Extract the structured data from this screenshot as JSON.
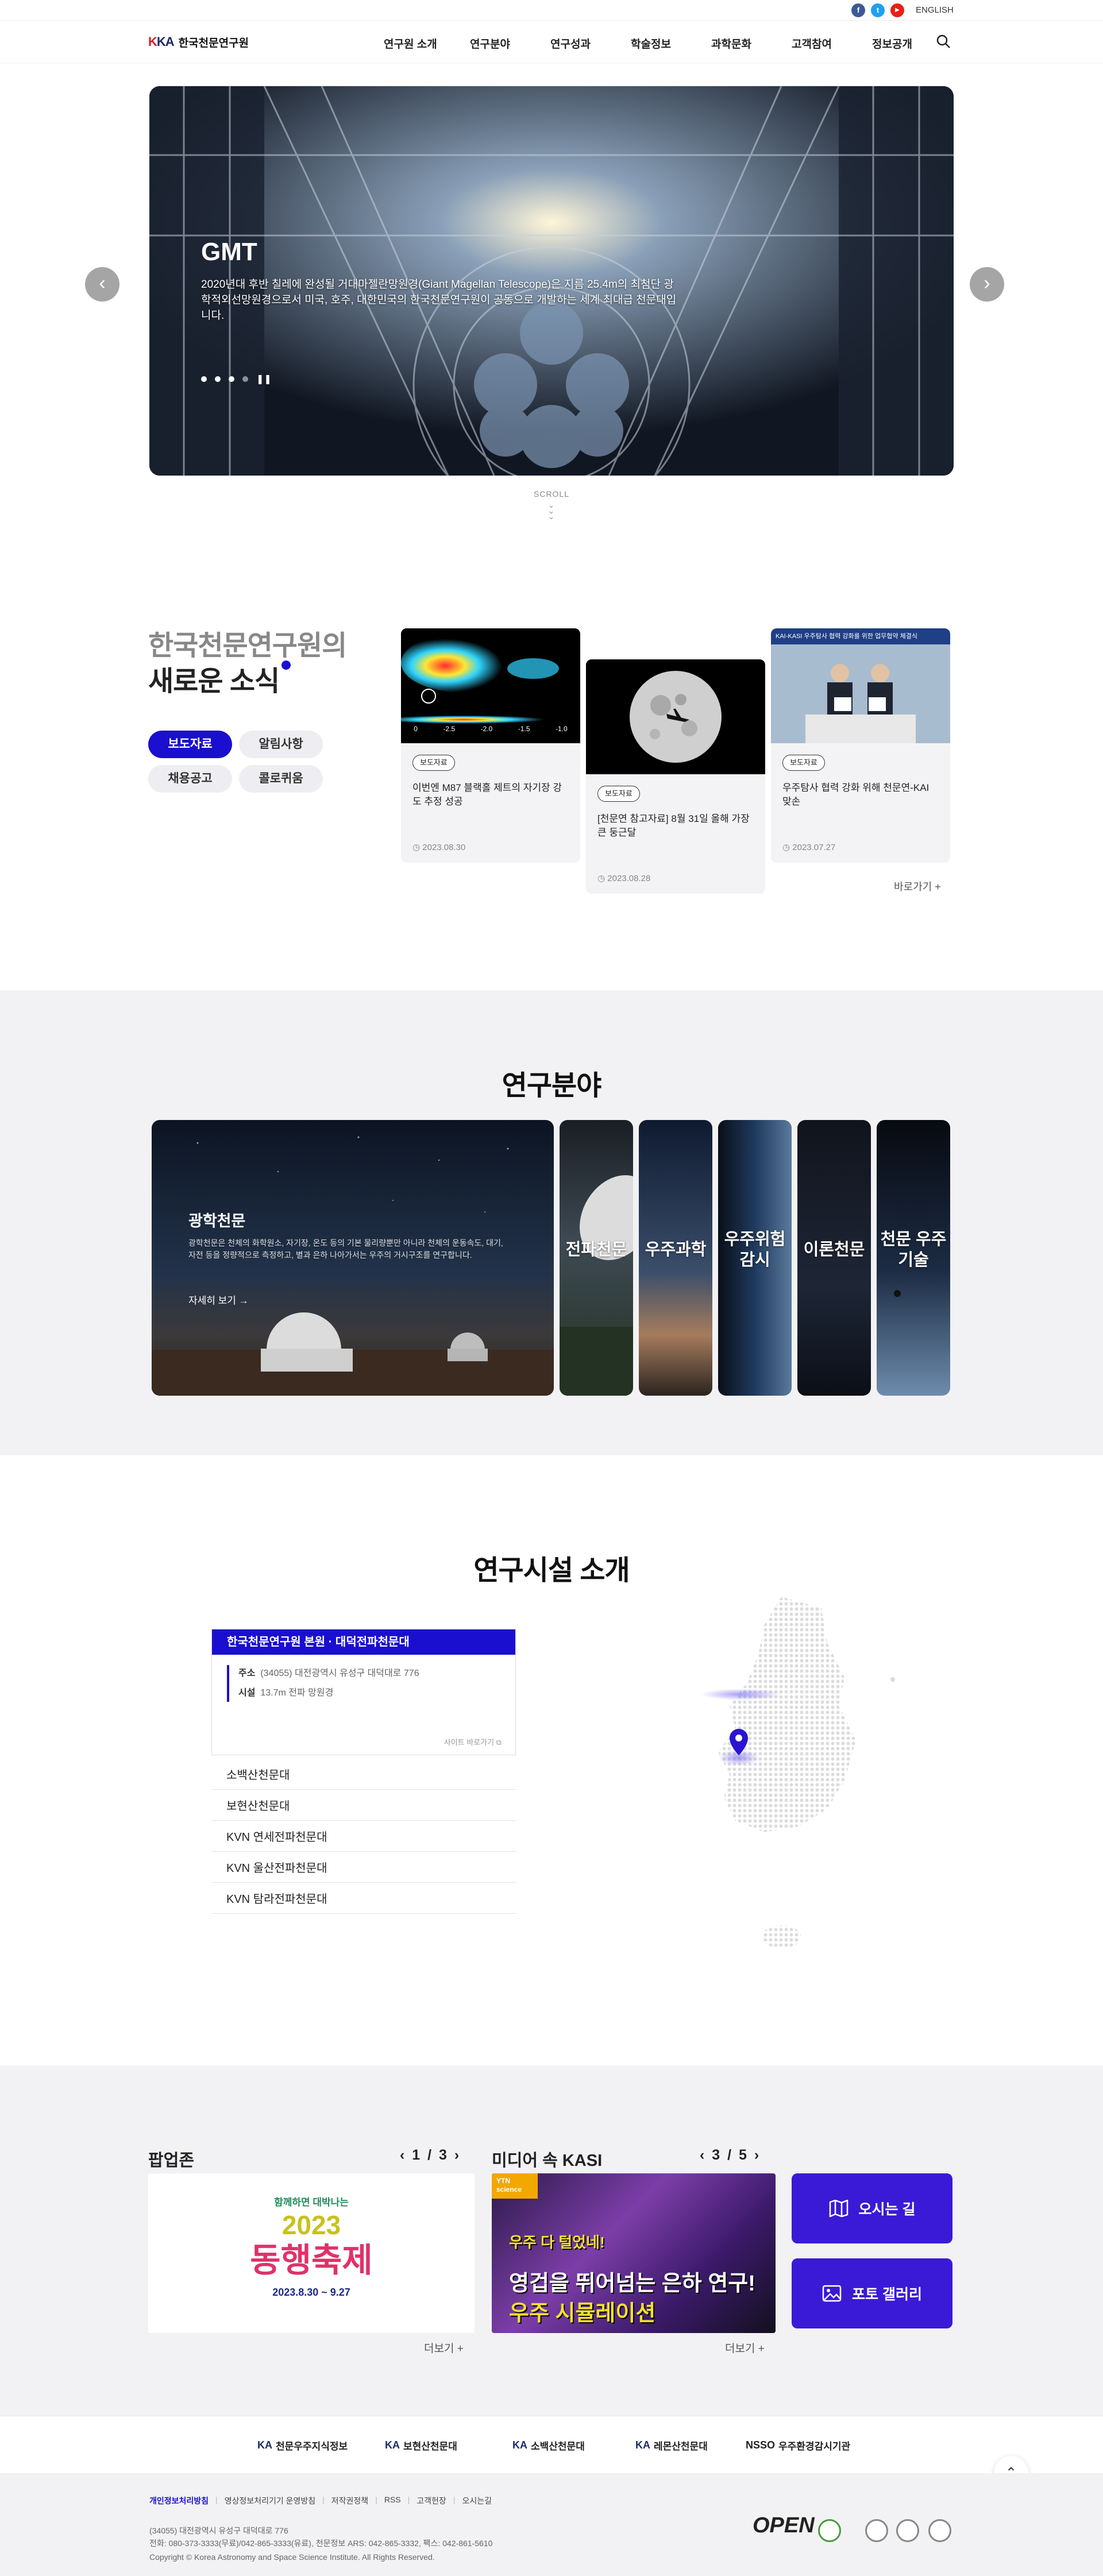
{
  "topbar": {
    "english": "ENGLISH",
    "sns": [
      "f",
      "t",
      "▶"
    ]
  },
  "header": {
    "logo_mark": "KA",
    "logo_name": "한국천문연구원",
    "nav": [
      "연구원 소개",
      "연구분야",
      "연구성과",
      "학술정보",
      "과학문화",
      "고객참여",
      "정보공개"
    ]
  },
  "hero": {
    "title": "GMT",
    "desc": "2020년대 후반 칠레에 완성될 거대마젤란망원경(Giant Magellan Telescope)은 지름 25.4m의 최첨단 광학적외선망원경으로서 미국, 호주, 대한민국의 한국천문연구원이 공동으로 개발하는 세계 최대급 천문대입니다.",
    "prev": "‹",
    "next": "›",
    "scroll": "SCROLL"
  },
  "news": {
    "title1": "한국천문연구원의",
    "title2": "새로운 소식",
    "chips": [
      "보도자료",
      "알림사항",
      "채용공고",
      "콜로퀴움"
    ],
    "cards": [
      {
        "badge": "보도자료",
        "title": "이번엔 M87 블랙홀 제트의 자기장 강도 추정 성공",
        "date": "2023.08.30"
      },
      {
        "badge": "보도자료",
        "title": "[천문연 참고자료] 8월 31일 올해 가장 큰 둥근달",
        "date": "2023.08.28"
      },
      {
        "badge": "보도자료",
        "title": "우주탐사 협력 강화 위해 천문연-KAI 맞손",
        "date": "2023.07.27"
      }
    ],
    "card1_scale": [
      "0",
      "-2.5",
      "-2.0",
      "-1.5",
      "-1.0"
    ],
    "card3_banner": "KAI-KASI 우주탐사 협력 강화를 위한 업무협약 체결식",
    "more": "바로가기"
  },
  "research": {
    "title": "연구분야",
    "main_title": "광학천문",
    "main_desc": "광학천문은 천체의 화학원소, 자기장, 온도 등의 기본 물리량뿐만 아니라 천체의 운동속도, 대기, 자전 등을 정량적으로 측정하고, 별과 은하 나아가서는 우주의 거시구조를 연구합니다.",
    "main_more": "자세히 보기",
    "panels": [
      "전파천문",
      "우주과학",
      "우주위험 감시",
      "이론천문",
      "천문 우주기술"
    ]
  },
  "facility": {
    "title": "연구시설 소개",
    "main_name": "한국천문연구원 본원 · 대덕전파천문대",
    "addr_label": "주소",
    "addr_value": "(34055) 대전광역시 유성구 대덕대로 776",
    "fac_label": "시설",
    "fac_value": "13.7m 전파 망원경",
    "site_link": "사이트 바로가기",
    "items": [
      "소백산천문대",
      "보현산천문대",
      "KVN 연세전파천문대",
      "KVN 울산전파천문대",
      "KVN 탐라전파천문대"
    ]
  },
  "popup": {
    "title": "팝업존",
    "page": "1 / 3",
    "banner_top": "함께하면 대박나는",
    "banner_year": "2023",
    "banner_main": "동행축제",
    "banner_date": "2023.8.30 ~ 9.27",
    "more": "더보기"
  },
  "media": {
    "title": "미디어 속 KASI",
    "page": "3 / 5",
    "tag": "YTN science",
    "line1": "우주 다 털었네!",
    "line2": "영겁을 뛰어넘는 은하 연구!",
    "line3": "우주 시뮬레이션",
    "more": "더보기"
  },
  "quick": {
    "directions": "오시는 길",
    "gallery": "포토 갤러리"
  },
  "family_sites": [
    "천문우주지식정보",
    "보현산천문대",
    "소백산천문대",
    "레몬산천문대",
    "우주환경감시기관"
  ],
  "footer": {
    "links": [
      "개인정보처리방침",
      "영상정보처리기기 운영방침",
      "저작권정책",
      "RSS",
      "고객헌장",
      "오시는길"
    ],
    "address": "(34055) 대전광역시 유성구 대덕대로 776",
    "contact": "전화: 080-373-3333(무료)/042-865-3333(유료),  천문정보 ARS: 042-865-3332,  팩스: 042-861-5610",
    "copyright": "Copyright © Korea Astronomy and Space Science Institute. All Rights Reserved.",
    "open_mark": "OPEN"
  },
  "colors": {
    "accent": "#1a0fcf",
    "button": "#3a1ad6",
    "panel_bg": "#f2f2f4"
  }
}
